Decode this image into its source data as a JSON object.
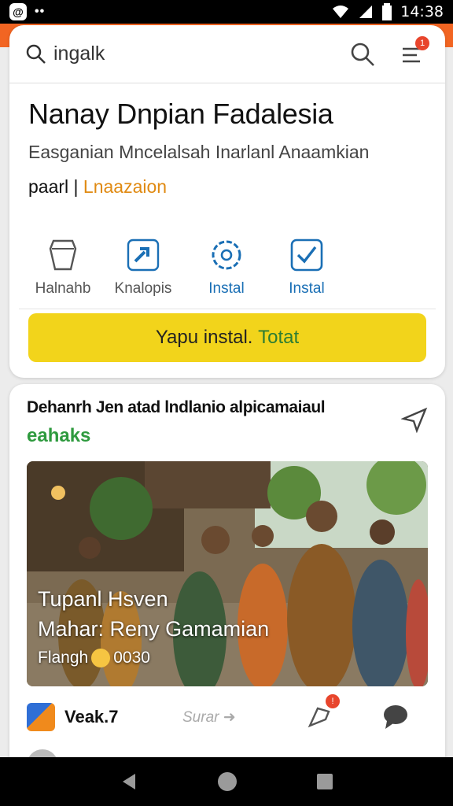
{
  "statusbar": {
    "time": "14:38"
  },
  "search": {
    "query": "ingalk"
  },
  "menu_badge": "1",
  "app": {
    "title": "Nanay Dnpian Fadalesia",
    "subtitle": "Easganian Mncelalsah Inarlanl Anaamkian",
    "tagline_prefix": "paarl",
    "tagline_highlight": "Lnaazaion"
  },
  "actions": [
    {
      "label": "Halnahb",
      "icon": "shield-icon"
    },
    {
      "label": "Knalopis",
      "icon": "share-icon"
    },
    {
      "label": "Instal",
      "icon": "gear-icon"
    },
    {
      "label": "Instal",
      "icon": "checkbox-icon"
    }
  ],
  "install_button": {
    "label": "Yapu instal.",
    "label_accent": "Totat"
  },
  "post": {
    "title": "Dehanrh Jen atad lndlanio alpicamaiaul",
    "tag": "eahaks",
    "caption_line1": "Tupanl Hsven",
    "caption_line2": "Mahar: Reny Gamamian",
    "caption_line3_prefix": "Flangh",
    "caption_line3_suffix": "0030",
    "source": "Veak.7",
    "share_label": "Surar",
    "bell_badge": "!"
  },
  "colors": {
    "accent": "#f26522",
    "install": "#f2d41b",
    "link_blue": "#1a6fb5",
    "green": "#2e9a3e"
  }
}
